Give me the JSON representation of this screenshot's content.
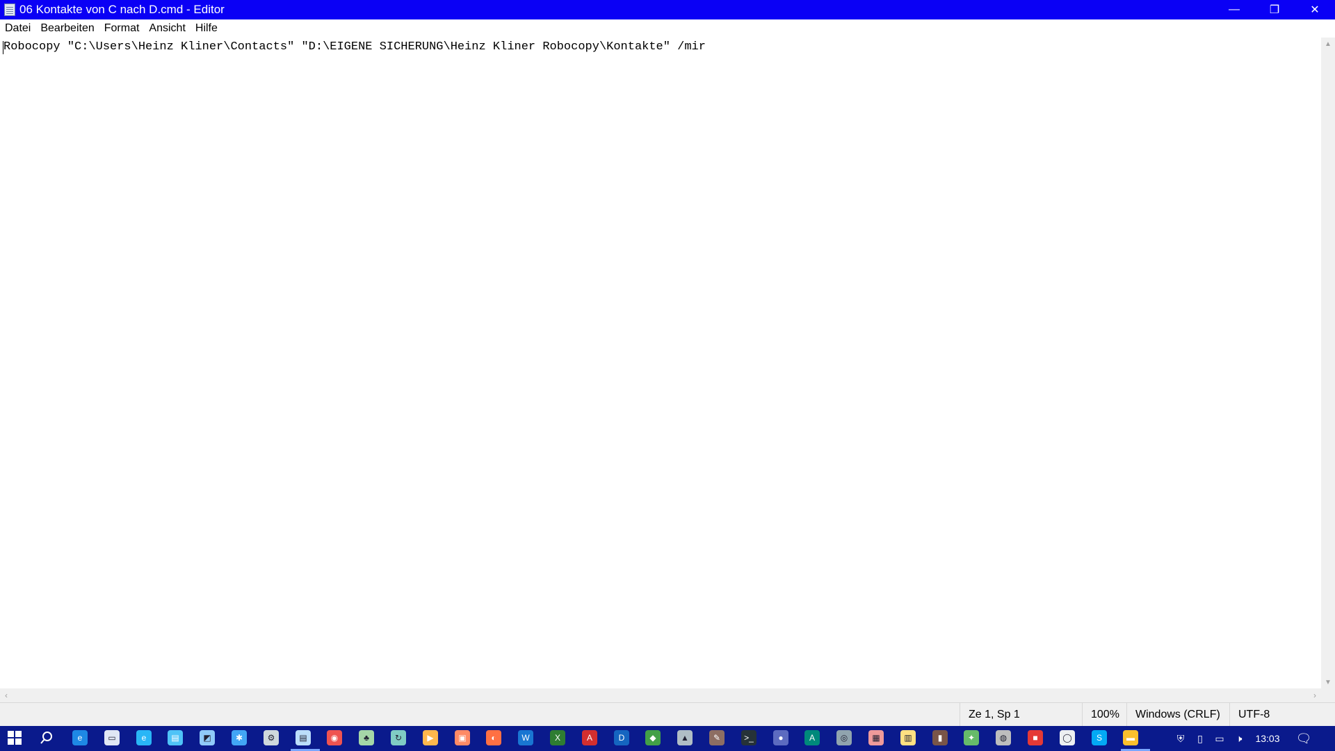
{
  "window": {
    "title": "06 Kontakte von C nach D.cmd - Editor",
    "controls": {
      "minimize": "—",
      "restore": "❐",
      "close": "✕"
    }
  },
  "menu": [
    "Datei",
    "Bearbeiten",
    "Format",
    "Ansicht",
    "Hilfe"
  ],
  "editor": {
    "content": "Robocopy \"C:\\Users\\Heinz Kliner\\Contacts\" \"D:\\EIGENE SICHERUNG\\Heinz Kliner Robocopy\\Kontakte\" /mir"
  },
  "status": {
    "position": "Ze 1, Sp 1",
    "zoom": "100%",
    "line_ending": "Windows (CRLF)",
    "encoding": "UTF-8"
  },
  "taskbar": {
    "clock": "13:03",
    "pinned": [
      {
        "name": "edge-icon",
        "color": "#1e88e5",
        "glyph": "e"
      },
      {
        "name": "file-explorer-icon",
        "color": "#e0e7f5",
        "glyph": "▭"
      },
      {
        "name": "internet-explorer-icon",
        "color": "#29b6f6",
        "glyph": "e"
      },
      {
        "name": "app-window-icon",
        "color": "#4fc3f7",
        "glyph": "▤"
      },
      {
        "name": "photo-app-icon",
        "color": "#90caf9",
        "glyph": "◩"
      },
      {
        "name": "network-app-icon",
        "color": "#42a5f5",
        "glyph": "✱"
      },
      {
        "name": "settings-gear-icon",
        "color": "#cfd8dc",
        "glyph": "⚙"
      },
      {
        "name": "notepad-icon",
        "color": "#bbdefb",
        "glyph": "▤"
      },
      {
        "name": "paint-app-icon",
        "color": "#ef5350",
        "glyph": "◉"
      },
      {
        "name": "tree-app-icon",
        "color": "#a5d6a7",
        "glyph": "♣"
      },
      {
        "name": "sync-app-icon",
        "color": "#80cbc4",
        "glyph": "↻"
      },
      {
        "name": "media-player-icon",
        "color": "#ffb74d",
        "glyph": "▶"
      },
      {
        "name": "toolbox-icon",
        "color": "#ff8a65",
        "glyph": "▣"
      },
      {
        "name": "firefox-icon",
        "color": "#ff7043",
        "glyph": "◐"
      },
      {
        "name": "word-icon",
        "color": "#1976d2",
        "glyph": "W"
      },
      {
        "name": "excel-icon",
        "color": "#2e7d32",
        "glyph": "X"
      },
      {
        "name": "acrobat-icon",
        "color": "#d32f2f",
        "glyph": "A"
      },
      {
        "name": "dse-app-icon",
        "color": "#1565c0",
        "glyph": "D"
      },
      {
        "name": "green-app-icon",
        "color": "#43a047",
        "glyph": "◆"
      },
      {
        "name": "education-icon",
        "color": "#b0bec5",
        "glyph": "▲"
      },
      {
        "name": "tools-app-icon",
        "color": "#8d6e63",
        "glyph": "✎"
      },
      {
        "name": "terminal-icon",
        "color": "#263238",
        "glyph": ">_"
      },
      {
        "name": "blue-circle-app-icon",
        "color": "#5c6bc0",
        "glyph": "●"
      },
      {
        "name": "publisher-icon",
        "color": "#00897b",
        "glyph": "A"
      },
      {
        "name": "browser-app-icon",
        "color": "#90a4ae",
        "glyph": "◎"
      },
      {
        "name": "calendar-app-icon",
        "color": "#ef9a9a",
        "glyph": "▦"
      },
      {
        "name": "archive-app-icon",
        "color": "#ffe082",
        "glyph": "▥"
      },
      {
        "name": "book-app-icon",
        "color": "#795548",
        "glyph": "▮"
      },
      {
        "name": "green-figure-app-icon",
        "color": "#66bb6a",
        "glyph": "✦"
      },
      {
        "name": "disc-app-icon",
        "color": "#bdbdbd",
        "glyph": "◍"
      },
      {
        "name": "red-app-icon",
        "color": "#e53935",
        "glyph": "■"
      },
      {
        "name": "white-circle-app-icon",
        "color": "#eceff1",
        "glyph": "◯"
      },
      {
        "name": "skype-icon",
        "color": "#03a9f4",
        "glyph": "S"
      },
      {
        "name": "folder-icon",
        "color": "#fbc02d",
        "glyph": "▬"
      }
    ]
  }
}
